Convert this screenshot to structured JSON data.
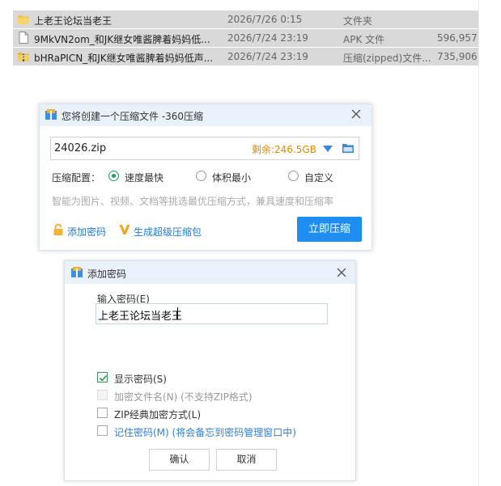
{
  "files": [
    {
      "name": "上老王论坛当老王",
      "date": "2026/7/26 0:15",
      "type": "文件夹",
      "size": "",
      "icon": "folder-icon"
    },
    {
      "name": "9MkVN2om_和JK继女唯酱脾着妈妈低...",
      "date": "2026/7/24 23:19",
      "type": "APK 文件",
      "size": "596,957",
      "icon": "document-icon"
    },
    {
      "name": "bHRaPICN_和JK继女唯酱脾着妈妈低声...",
      "date": "2026/7/24 23:19",
      "type": "压缩(zipped)文件...",
      "size": "735,906",
      "icon": "zip-folder-icon"
    }
  ],
  "compress_dialog": {
    "title": "您将创建一个压缩文件 -360压缩",
    "filename": "24026.zip",
    "free_space": "剩余:246.5GB",
    "config_label": "压缩配置：",
    "options": [
      {
        "label": "速度最快",
        "selected": true
      },
      {
        "label": "体积最小",
        "selected": false
      },
      {
        "label": "自定义",
        "selected": false
      }
    ],
    "hint": "智能为图片、视频、文档等挑选最优压缩方式，兼具速度和压缩率",
    "add_password": "添加密码",
    "super_pack": "生成超级压缩包",
    "compress_now": "立即压缩"
  },
  "password_dialog": {
    "title": "添加密码",
    "input_label": "输入密码(E)",
    "password_value": "上老王论坛当老王",
    "checkboxes": [
      {
        "label": "显示密码(S)",
        "checked": true,
        "disabled": false
      },
      {
        "label": "加密文件名(N) (不支持ZIP格式)",
        "checked": false,
        "disabled": true
      },
      {
        "label": "ZIP经典加密方式(L)",
        "checked": false,
        "disabled": false
      },
      {
        "label": "记住密码(M) (将会备忘到密码管理窗口中)",
        "checked": false,
        "disabled": false
      }
    ],
    "ok": "确认",
    "cancel": "取消"
  },
  "colors": {
    "accent": "#1e8ff0",
    "free_space": "#e08a00",
    "link": "#1d7bd6",
    "selected_row": "#d9d9d9"
  }
}
